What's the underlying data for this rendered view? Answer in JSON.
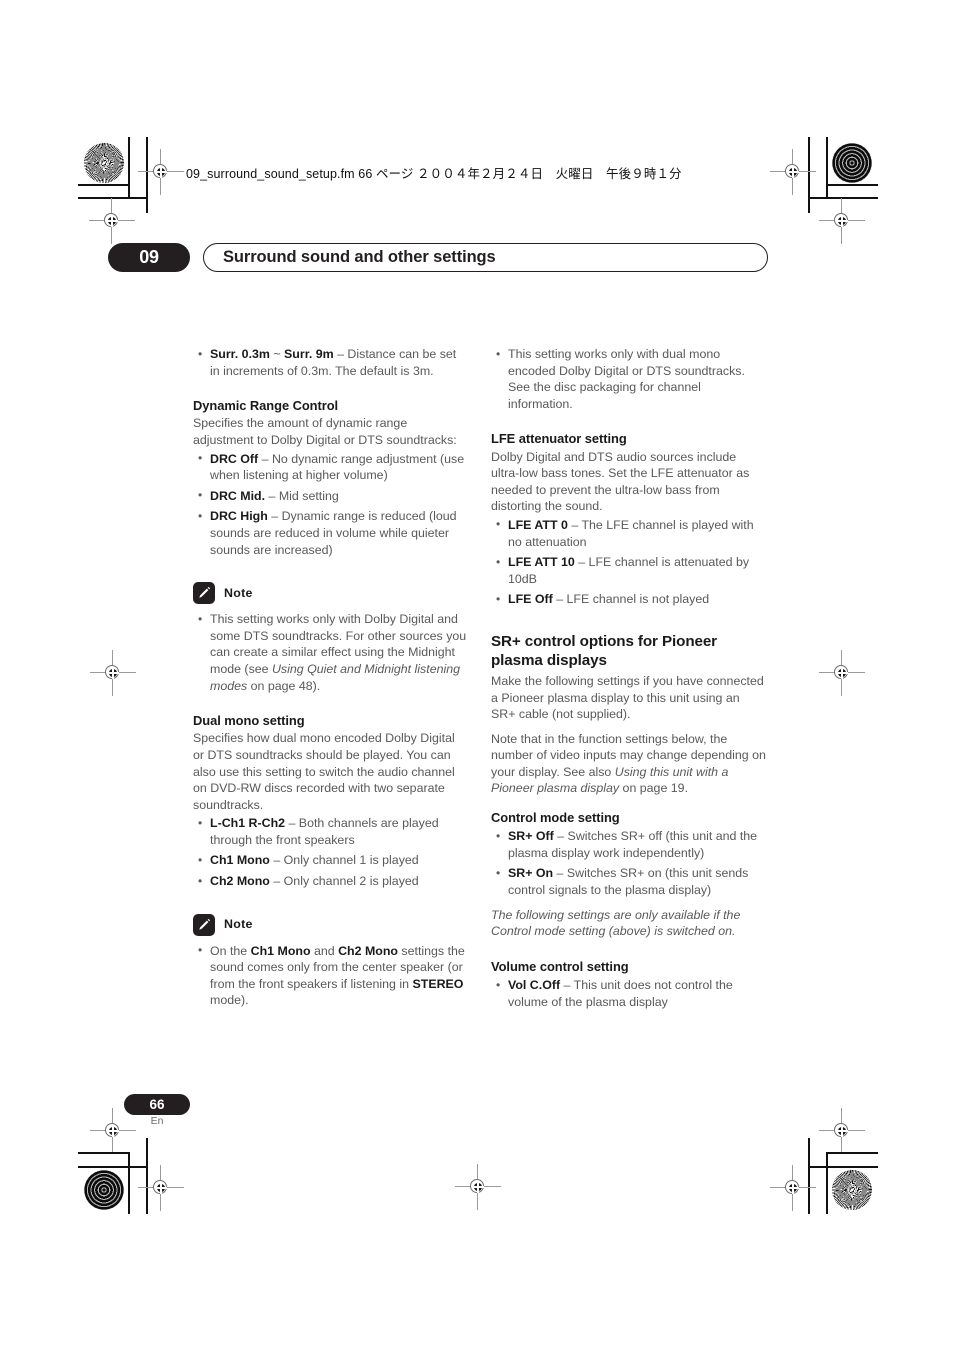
{
  "running_head": "09_surround_sound_setup.fm  66 ページ  ２００４年２月２４日　火曜日　午後９時１分",
  "chapter": {
    "number": "09",
    "title": "Surround sound and other settings"
  },
  "footer": {
    "page_number": "66",
    "language_code": "En"
  },
  "note_label": "Note",
  "left_column": {
    "surr_bullet": {
      "term_a": "Surr. 0.3m",
      "tilde": " ~ ",
      "term_b": "Surr. 9m",
      "desc": " – Distance can be set in increments of 0.3m. The default is 3m."
    },
    "drc": {
      "heading": "Dynamic Range Control",
      "intro": "Specifies the amount of dynamic range adjustment to Dolby Digital or DTS soundtracks:",
      "items": [
        {
          "term": "DRC Off",
          "desc": " – No dynamic range adjustment (use when listening at higher volume)"
        },
        {
          "term": "DRC Mid.",
          "desc": " – Mid setting"
        },
        {
          "term": "DRC High",
          "desc": " – Dynamic range is reduced (loud sounds are reduced in volume while quieter sounds are increased)"
        }
      ]
    },
    "note_1": {
      "part_1": "This setting works only with Dolby Digital and some DTS soundtracks. For other sources you can create a similar effect using the Midnight mode (see ",
      "italic": "Using Quiet and Midnight listening modes",
      "part_2": " on page 48)."
    },
    "dual_mono": {
      "heading": "Dual mono setting",
      "intro": "Specifies how dual mono encoded Dolby Digital or DTS soundtracks should be played. You can also use this setting to switch the audio channel on DVD-RW discs recorded with two separate soundtracks.",
      "items": [
        {
          "term": "L-Ch1 R-Ch2",
          "desc": " – Both channels are played through the front speakers"
        },
        {
          "term": "Ch1 Mono",
          "desc": " – Only channel 1 is played"
        },
        {
          "term": "Ch2 Mono",
          "desc": " – Only channel 2 is played"
        }
      ]
    },
    "note_2": {
      "part_1": "On the ",
      "bold_1": "Ch1 Mono",
      "part_2": " and ",
      "bold_2": "Ch2 Mono",
      "part_3": " settings the sound comes only from the center speaker (or from the front speakers if listening in ",
      "bold_3": "STEREO",
      "part_4": " mode)."
    }
  },
  "right_column": {
    "note_3": "This setting works only with dual mono encoded Dolby Digital or DTS soundtracks. See the disc packaging for channel information.",
    "lfe": {
      "heading": "LFE attenuator setting",
      "intro": "Dolby Digital and DTS audio sources include ultra-low bass tones. Set the LFE attenuator as needed to prevent the ultra-low bass from distorting the sound.",
      "items": [
        {
          "term": "LFE ATT 0",
          "desc": " – The LFE channel is played with no attenuation"
        },
        {
          "term": "LFE ATT 10",
          "desc": " – LFE channel is attenuated by 10dB"
        },
        {
          "term": "LFE Off",
          "desc": " – LFE channel is not played"
        }
      ]
    },
    "srplus": {
      "heading": "SR+ control options for Pioneer plasma displays",
      "para_1": "Make the following settings if you have connected a Pioneer plasma display to this unit using an SR+ cable (not supplied).",
      "para_2_part_1": "Note that in the function settings below, the number of video inputs may change depending on your display. See also ",
      "para_2_italic": "Using this unit with a Pioneer plasma display",
      "para_2_part_2": " on page 19."
    },
    "control_mode": {
      "heading": "Control mode setting",
      "items": [
        {
          "term": "SR+ Off",
          "desc": " – Switches SR+ off (this unit and the plasma display work independently)"
        },
        {
          "term": "SR+ On",
          "desc": " – Switches SR+ on (this unit sends control signals to the plasma display)"
        }
      ],
      "footnote": "The following settings are only available if the Control mode setting (above) is switched on."
    },
    "volume_control": {
      "heading": "Volume control setting",
      "items": [
        {
          "term": "Vol C.Off",
          "desc": " – This unit does not control the volume of the plasma display"
        }
      ]
    }
  }
}
